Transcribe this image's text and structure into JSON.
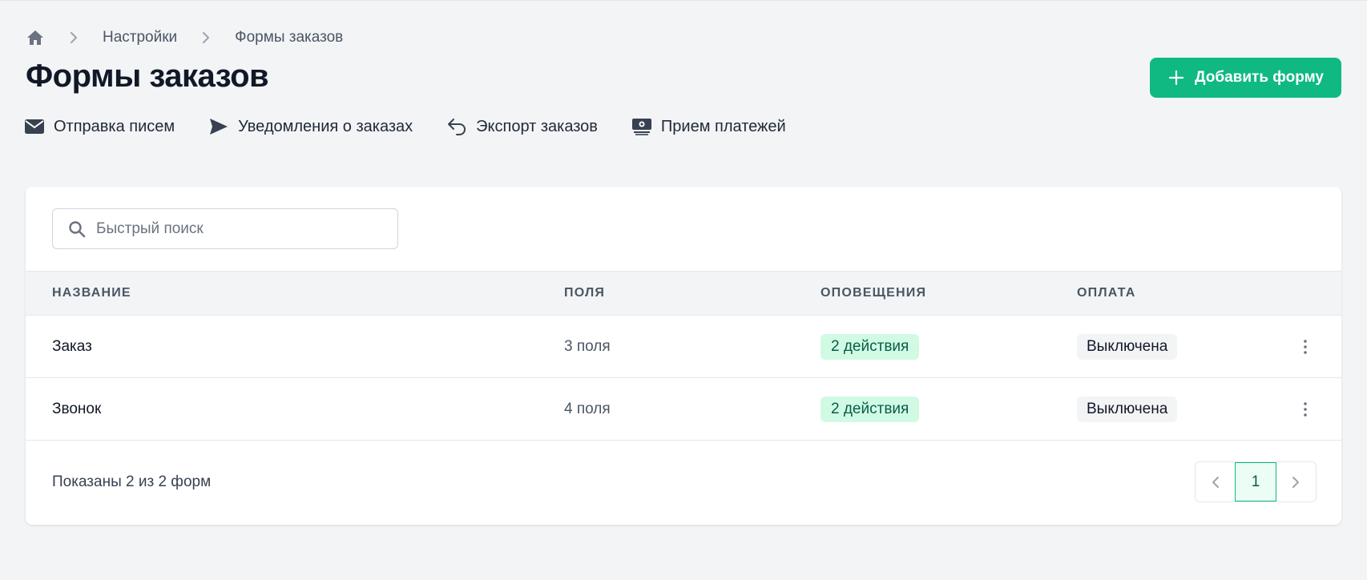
{
  "breadcrumb": {
    "home_icon": "home-icon",
    "items": [
      "Настройки",
      "Формы заказов"
    ]
  },
  "page": {
    "title": "Формы заказов",
    "add_button_label": "Добавить форму"
  },
  "subnav": [
    {
      "label": "Отправка писем",
      "icon": "envelope-icon"
    },
    {
      "label": "Уведомления о заказах",
      "icon": "paper-plane-icon"
    },
    {
      "label": "Экспорт заказов",
      "icon": "reply-arrow-icon"
    },
    {
      "label": "Прием платежей",
      "icon": "money-bill-icon"
    }
  ],
  "search": {
    "placeholder": "Быстрый поиск",
    "value": ""
  },
  "table": {
    "columns": [
      "НАЗВАНИЕ",
      "ПОЛЯ",
      "ОПОВЕЩЕНИЯ",
      "ОПЛАТА"
    ],
    "rows": [
      {
        "name": "Заказ",
        "fields": "3 поля",
        "notifications": "2 действия",
        "payment": "Выключена"
      },
      {
        "name": "Звонок",
        "fields": "4 поля",
        "notifications": "2 действия",
        "payment": "Выключена"
      }
    ]
  },
  "footer": {
    "summary": "Показаны 2 из 2 форм",
    "current_page": "1"
  },
  "colors": {
    "accent": "#10b981",
    "badge_green_bg": "#d1fae5",
    "badge_green_text": "#065f46",
    "badge_gray_bg": "#f3f4f6",
    "background": "#f3f4f6"
  }
}
